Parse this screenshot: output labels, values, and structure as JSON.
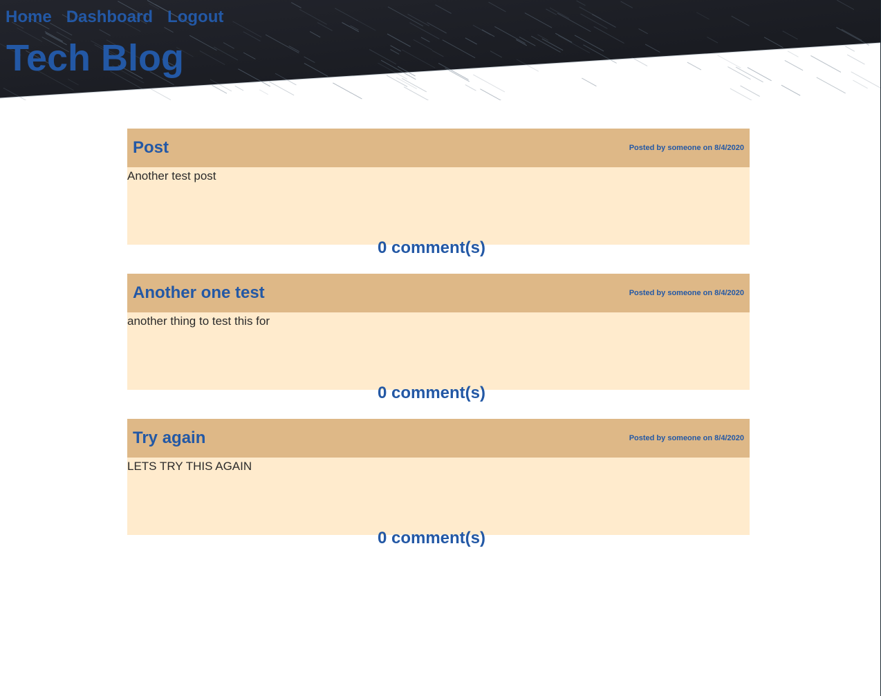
{
  "nav": {
    "home": "Home",
    "dashboard": "Dashboard",
    "logout": "Logout"
  },
  "site": {
    "title": "Tech Blog"
  },
  "posts": [
    {
      "title": "Post",
      "meta": "Posted by someone on 8/4/2020",
      "body": "Another test post",
      "comments": "0 comment(s)"
    },
    {
      "title": "Another one test",
      "meta": "Posted by someone on 8/4/2020",
      "body": "another thing to test this for",
      "comments": "0 comment(s)"
    },
    {
      "title": "Try again",
      "meta": "Posted by someone on 8/4/2020",
      "body": "LETS TRY THIS AGAIN",
      "comments": "0 comment(s)"
    }
  ],
  "colors": {
    "link": "#2358a5",
    "post_header": "#deb887",
    "post_body": "#ffebcd",
    "header_bg": "#1c1e26"
  }
}
